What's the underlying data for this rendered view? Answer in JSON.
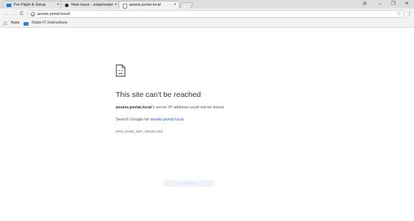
{
  "tabs": [
    {
      "title": "Pre-Flight & Setup",
      "close": "×",
      "favicon": "blue-book-favicon",
      "active": false
    },
    {
      "title": "New Issue · snipe/snipe",
      "close": "×",
      "favicon": "github-favicon",
      "active": false
    },
    {
      "title": "assets.portal.local",
      "close": "×",
      "favicon": "page-favicon",
      "active": true
    }
  ],
  "window_controls": {
    "profile": "⊝",
    "minimize": "–",
    "restore": "❐",
    "close": "✕"
  },
  "toolbar": {
    "back": "←",
    "forward": "→",
    "reload": "C",
    "url": "assets.portal.local/",
    "info_icon": "i",
    "star": "☆",
    "menu": "⋮"
  },
  "bookmarks": {
    "apps_label": "Apps",
    "items": [
      {
        "label": "Snipe-IT Instructions"
      }
    ]
  },
  "error": {
    "title": "This site can't be reached",
    "host": "assets.portal.local",
    "desc_rest": "'s server IP address could not be found.",
    "search_prefix": "Search Google for ",
    "search_link": "assets portal local",
    "code": "ERR_NAME_NOT_RESOLVED",
    "details_button": "DETAILS"
  },
  "colors": {
    "link": "#1a5fbf",
    "apps_dots": [
      "#ea4335",
      "#fbbc05",
      "#34a853",
      "#4285f4",
      "#ea4335",
      "#fbbc05",
      "#34a853",
      "#4285f4",
      "#ea4335"
    ]
  }
}
